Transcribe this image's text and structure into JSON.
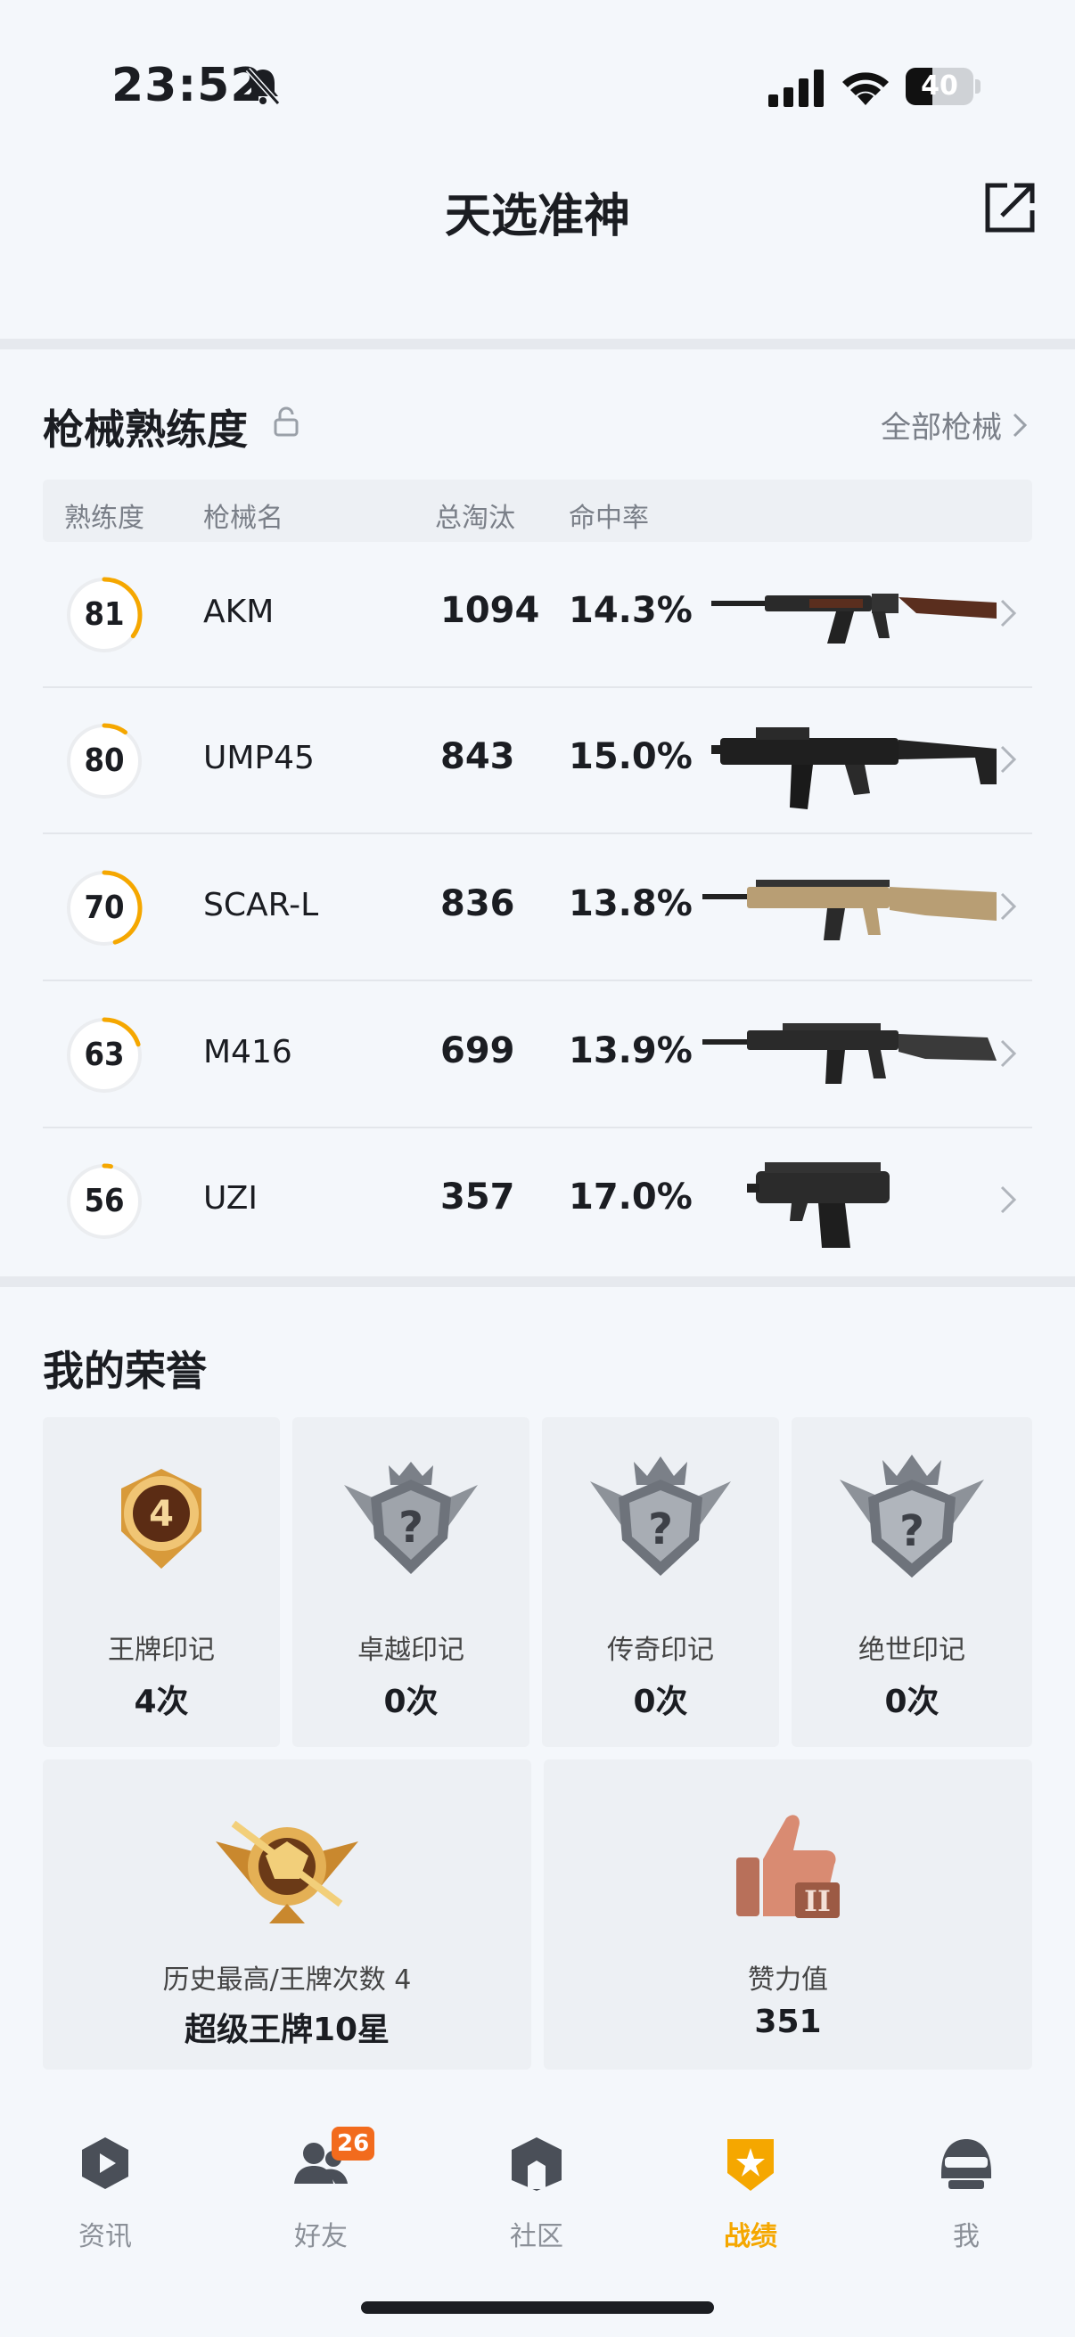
{
  "status_bar": {
    "time": "23:52",
    "battery_level": "40",
    "battery_fraction": 0.4
  },
  "header": {
    "title": "天选准神"
  },
  "weapons": {
    "section_title": "枪械熟练度",
    "all_link": "全部枪械",
    "columns": {
      "mastery": "熟练度",
      "name": "枪械名",
      "kills": "总淘汰",
      "accuracy": "命中率"
    },
    "rows": [
      {
        "mastery": "81",
        "progress": 0.35,
        "name": "AKM",
        "kills": "1094",
        "accuracy": "14.3%"
      },
      {
        "mastery": "80",
        "progress": 0.1,
        "name": "UMP45",
        "kills": "843",
        "accuracy": "15.0%"
      },
      {
        "mastery": "70",
        "progress": 0.45,
        "name": "SCAR-L",
        "kills": "836",
        "accuracy": "13.8%"
      },
      {
        "mastery": "63",
        "progress": 0.2,
        "name": "M416",
        "kills": "699",
        "accuracy": "13.9%"
      },
      {
        "mastery": "56",
        "progress": 0.03,
        "name": "UZI",
        "kills": "357",
        "accuracy": "17.0%"
      }
    ]
  },
  "honors": {
    "section_title": "我的荣誉",
    "marks": [
      {
        "label": "王牌印记",
        "value": "4次",
        "badge_number": "4"
      },
      {
        "label": "卓越印记",
        "value": "0次"
      },
      {
        "label": "传奇印记",
        "value": "0次"
      },
      {
        "label": "绝世印记",
        "value": "0次"
      }
    ],
    "highest": {
      "label": "历史最高/王牌次数 4",
      "value": "超级王牌10星"
    },
    "likes": {
      "label": "赞力值",
      "value": "351"
    }
  },
  "tabbar": {
    "items": [
      {
        "label": "资讯"
      },
      {
        "label": "好友",
        "badge": "26"
      },
      {
        "label": "社区"
      },
      {
        "label": "战绩",
        "active": true
      },
      {
        "label": "我"
      }
    ]
  },
  "colors": {
    "accent": "#f5a700",
    "badge": "#f26b1d",
    "background": "#f4f7fb"
  }
}
